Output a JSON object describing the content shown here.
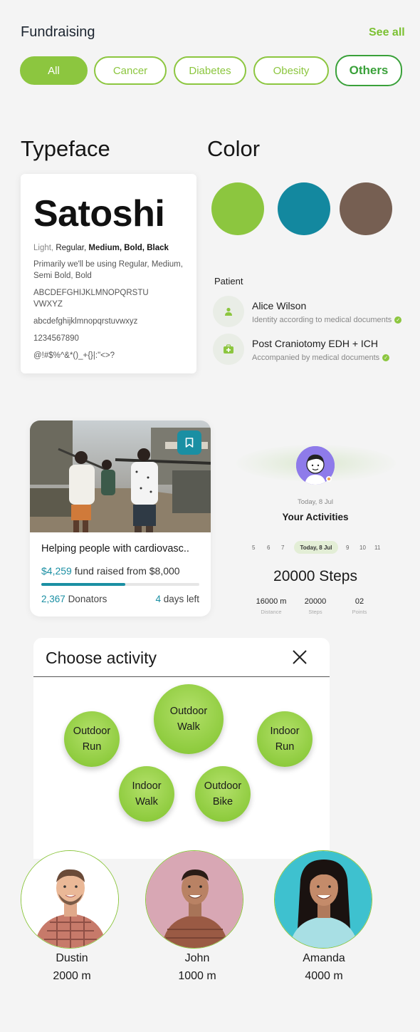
{
  "fundraising": {
    "title": "Fundraising",
    "see_all": "See all",
    "filters": [
      "All",
      "Cancer",
      "Diabetes",
      "Obesity",
      "Others"
    ]
  },
  "typeface": {
    "heading": "Typeface",
    "font_name": "Satoshi",
    "weights": {
      "light": "Light,",
      "regular": "Regular,",
      "medium": "Medium,",
      "bold": "Bold,",
      "black": "Black"
    },
    "usage_line1": "Primarily we'll be using Regular, Medium,",
    "usage_line2": "Semi Bold, Bold",
    "upper1": "ABCDEFGHIJKLMNOPQRSTU",
    "upper2": "VWXYZ",
    "lower": "abcdefghijklmnopqrstuvwxyz",
    "digits": "1234567890",
    "symbols": "@!#$%^&*()_+{}|:\"<>?"
  },
  "color": {
    "heading": "Color",
    "swatches": [
      "#8cc63f",
      "#13889f",
      "#765f52"
    ]
  },
  "patient": {
    "label": "Patient",
    "items": [
      {
        "title": "Alice Wilson",
        "subtitle": "Identity according to medical documents",
        "icon": "person-icon"
      },
      {
        "title": "Post Craniotomy EDH + ICH",
        "subtitle": "Accompanied by medical documents",
        "icon": "medical-kit-icon"
      }
    ]
  },
  "campaign": {
    "title": "Helping people with cardiovasc..",
    "raised": "$4,259",
    "raised_suffix": "fund raised from $8,000",
    "progress": 0.53,
    "donators_count": "2,367",
    "donators_label": "Donators",
    "days_count": "4",
    "days_label": "days left"
  },
  "activities": {
    "date": "Today, 8 Jul",
    "title": "Your Activities",
    "days": [
      "5",
      "6",
      "7",
      "Today, 8 Jul",
      "9",
      "10",
      "11"
    ],
    "steps": "20000 Steps",
    "stats": [
      {
        "value": "16000 m",
        "label": "Distance"
      },
      {
        "value": "20000",
        "label": "Steps"
      },
      {
        "value": "02",
        "label": "Points"
      }
    ]
  },
  "choose": {
    "title": "Choose activity",
    "options": [
      {
        "l1": "Outdoor",
        "l2": "Walk"
      },
      {
        "l1": "Outdoor",
        "l2": "Run"
      },
      {
        "l1": "Indoor",
        "l2": "Run"
      },
      {
        "l1": "Indoor",
        "l2": "Walk"
      },
      {
        "l1": "Outdoor",
        "l2": "Bike"
      }
    ]
  },
  "people": [
    {
      "name": "Dustin",
      "distance": "2000 m"
    },
    {
      "name": "John",
      "distance": "1000 m"
    },
    {
      "name": "Amanda",
      "distance": "4000 m"
    }
  ]
}
